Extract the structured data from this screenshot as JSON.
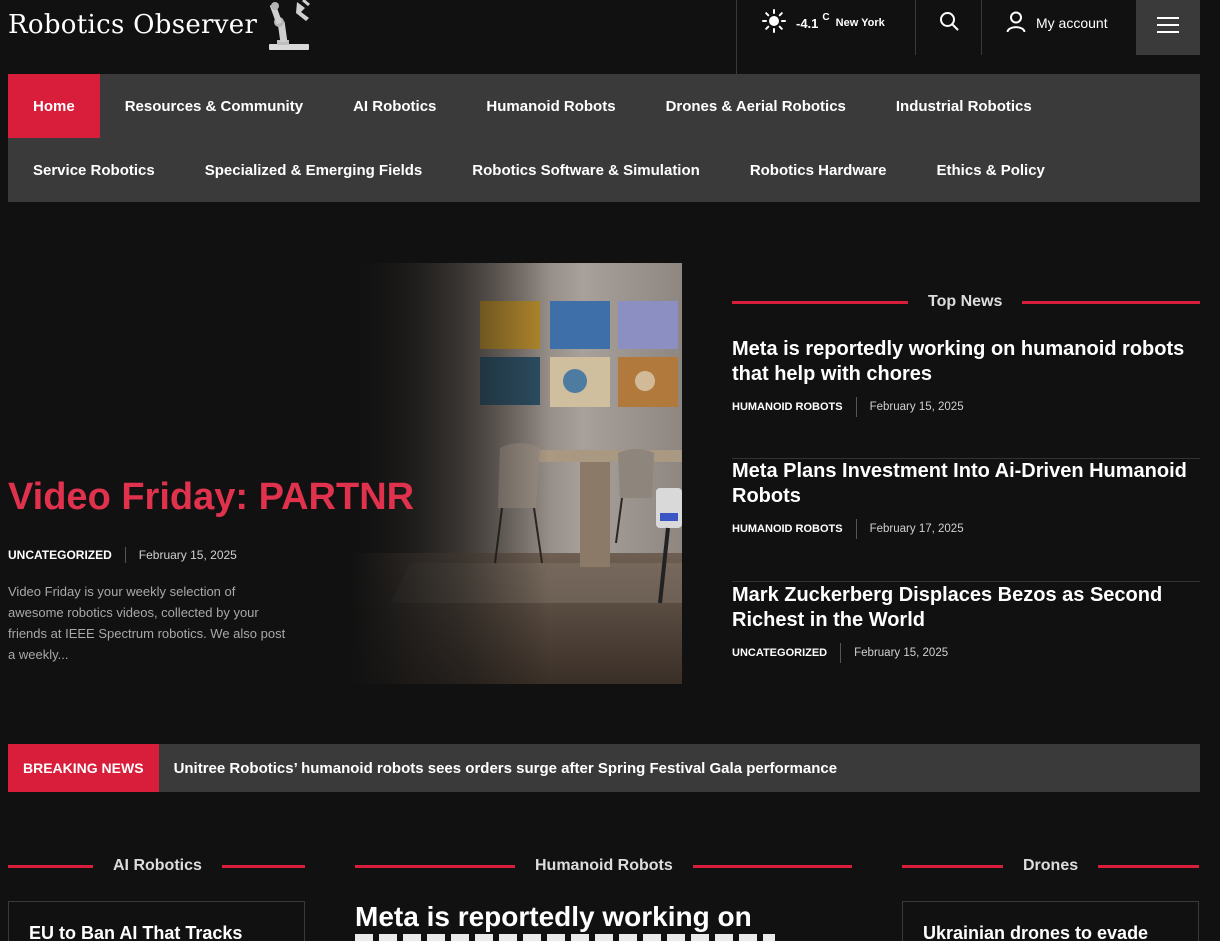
{
  "site": {
    "name": "Robotics Observer"
  },
  "header": {
    "weather": {
      "temp": "-4.1",
      "unit": "C",
      "city": "New York"
    },
    "account_label": "My account"
  },
  "nav": {
    "row1": [
      "Home",
      "Resources & Community",
      "AI Robotics",
      "Humanoid Robots",
      "Drones & Aerial Robotics",
      "Industrial Robotics"
    ],
    "row2": [
      "Service Robotics",
      "Specialized & Emerging Fields",
      "Robotics Software & Simulation",
      "Robotics Hardware",
      "Ethics & Policy"
    ],
    "active": "Home"
  },
  "hero": {
    "title": "Video Friday: PARTNR",
    "category": "UNCATEGORIZED",
    "date": "February 15, 2025",
    "excerpt": "Video Friday is your weekly selection of awesome robotics videos, collected by your friends at IEEE Spectrum robotics. We also post a weekly..."
  },
  "top_news": {
    "heading": "Top News",
    "items": [
      {
        "title": "Meta is reportedly working on humanoid robots that help with chores",
        "category": "HUMANOID ROBOTS",
        "date": "February 15, 2025"
      },
      {
        "title": "Meta Plans Investment Into Ai-Driven Humanoid Robots",
        "category": "HUMANOID ROBOTS",
        "date": "February 17, 2025"
      },
      {
        "title": "Mark Zuckerberg Displaces Bezos as Second Richest in the World",
        "category": "UNCATEGORIZED",
        "date": "February 15, 2025"
      }
    ]
  },
  "breaking": {
    "label": "BREAKING NEWS",
    "text": "Unitree Robotics’ humanoid robots sees orders surge after Spring Festival Gala performance"
  },
  "sections": {
    "ai": {
      "heading": "AI Robotics",
      "first_title": "EU to Ban AI That Tracks"
    },
    "humanoid": {
      "heading": "Humanoid Robots",
      "first_title": "Meta is reportedly working on"
    },
    "drones": {
      "heading": "Drones",
      "first_title": "Ukrainian drones to evade"
    }
  },
  "colors": {
    "accent": "#d81e3a",
    "background": "#111111",
    "panel": "#3a3a3a"
  },
  "icons": {
    "weather": "sun-icon",
    "search": "search-icon",
    "account": "user-icon",
    "menu": "hamburger-menu-icon"
  }
}
